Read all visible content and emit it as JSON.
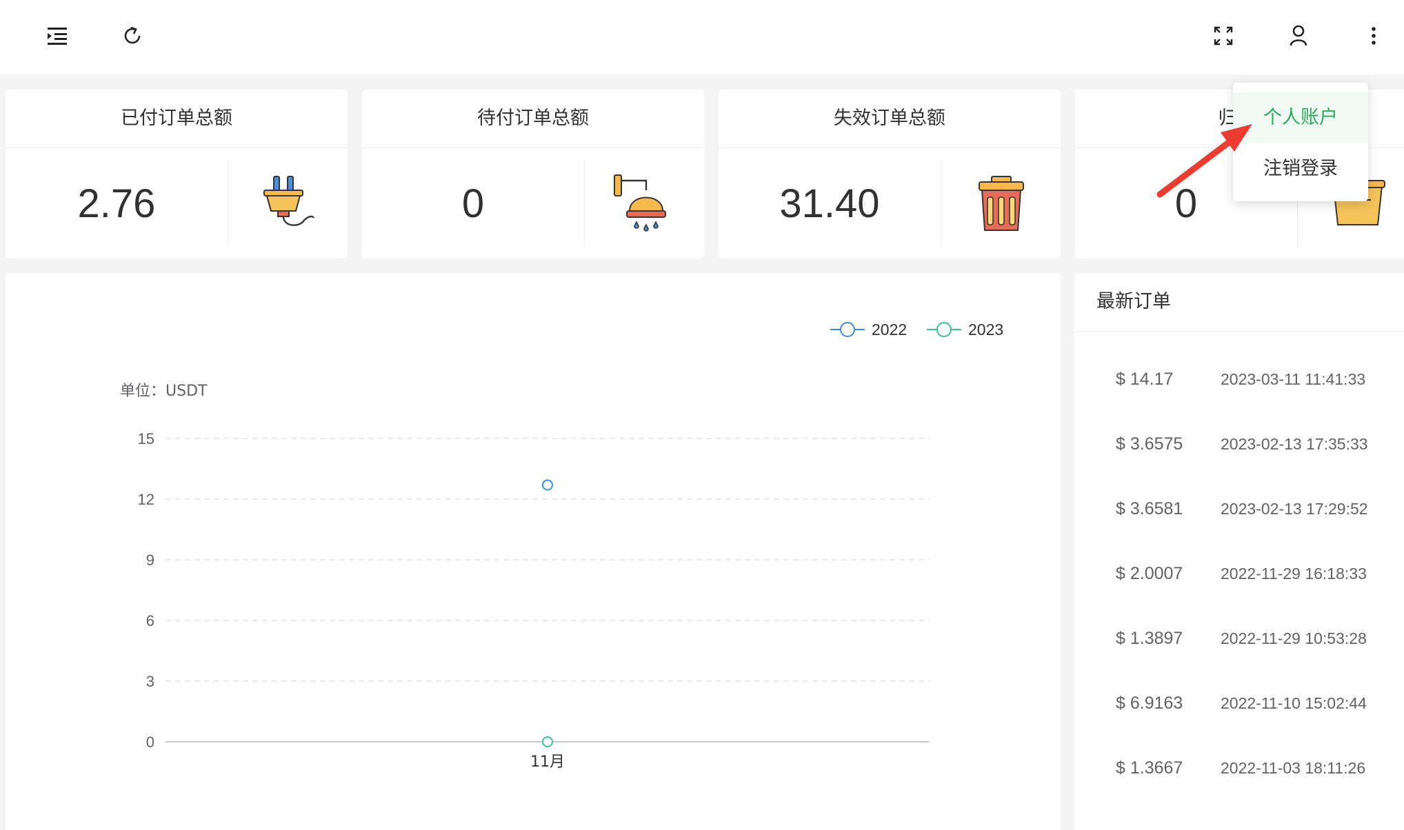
{
  "topbar": {
    "collapse_icon": "menu-fold-icon",
    "refresh_icon": "refresh-icon",
    "fullscreen_icon": "fullscreen-icon",
    "user_icon": "user-icon",
    "more_icon": "more-vertical-icon"
  },
  "cards": [
    {
      "title": "已付订单总额",
      "value": "2.76",
      "icon": "plug-icon"
    },
    {
      "title": "待付订单总额",
      "value": "0",
      "icon": "shower-icon"
    },
    {
      "title": "失效订单总额",
      "value": "31.40",
      "icon": "trash-bin-icon"
    },
    {
      "title": "归集订",
      "value": "0",
      "icon": "bucket-icon"
    }
  ],
  "dropdown": {
    "items": [
      {
        "label": "个人账户",
        "active": true
      },
      {
        "label": "注销登录",
        "active": false
      }
    ]
  },
  "chart_data": {
    "type": "line",
    "ylabel": "单位：USDT",
    "yticks": [
      "15",
      "12",
      "9",
      "6",
      "3",
      "0"
    ],
    "ylim": [
      0,
      15
    ],
    "categories": [
      "11月"
    ],
    "series": [
      {
        "name": "2022",
        "values": [
          12.7
        ],
        "color": "#3a8ee6"
      },
      {
        "name": "2023",
        "values": [
          0
        ],
        "color": "#36c393"
      }
    ],
    "grid": true,
    "legend": "top-right"
  },
  "orders": {
    "title": "最新订单",
    "rows": [
      {
        "amount": "$ 14.17",
        "time": "2023-03-11 11:41:33"
      },
      {
        "amount": "$ 3.6575",
        "time": "2023-02-13 17:35:33"
      },
      {
        "amount": "$ 3.6581",
        "time": "2023-02-13 17:29:52"
      },
      {
        "amount": "$ 2.0007",
        "time": "2022-11-29 16:18:33"
      },
      {
        "amount": "$ 1.3897",
        "time": "2022-11-29 10:53:28"
      },
      {
        "amount": "$ 6.9163",
        "time": "2022-11-10 15:02:44"
      },
      {
        "amount": "$ 1.3667",
        "time": "2022-11-03 18:11:26"
      }
    ]
  },
  "colors": {
    "accent_green": "#2aad5b",
    "arrow_red": "#ee3b30",
    "series_2022": "#3a8ee6",
    "series_2023": "#36c393"
  }
}
